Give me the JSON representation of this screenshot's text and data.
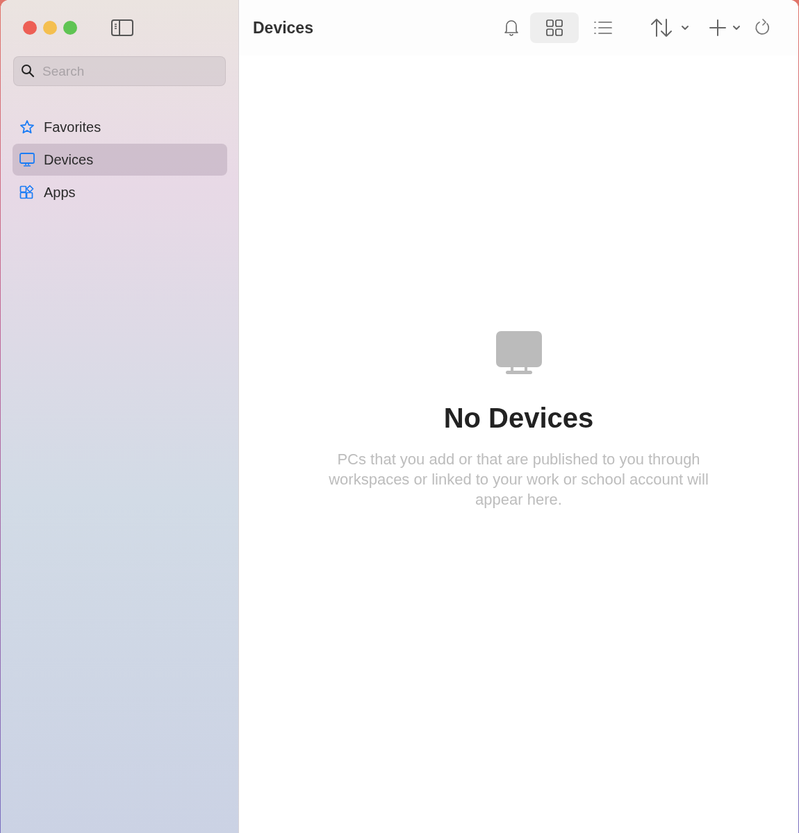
{
  "sidebar": {
    "search": {
      "placeholder": "Search"
    },
    "items": [
      {
        "label": "Favorites",
        "kind": "star",
        "selected": false
      },
      {
        "label": "Devices",
        "kind": "monitor",
        "selected": true
      },
      {
        "label": "Apps",
        "kind": "apps",
        "selected": false
      }
    ]
  },
  "toolbar": {
    "title": "Devices",
    "view_modes": [
      {
        "kind": "grid",
        "selected": true
      },
      {
        "kind": "list",
        "selected": false
      }
    ]
  },
  "empty_state": {
    "title": "No Devices",
    "message": "PCs that you add or that are published to you through workspaces or linked to your work or school account will appear here."
  }
}
